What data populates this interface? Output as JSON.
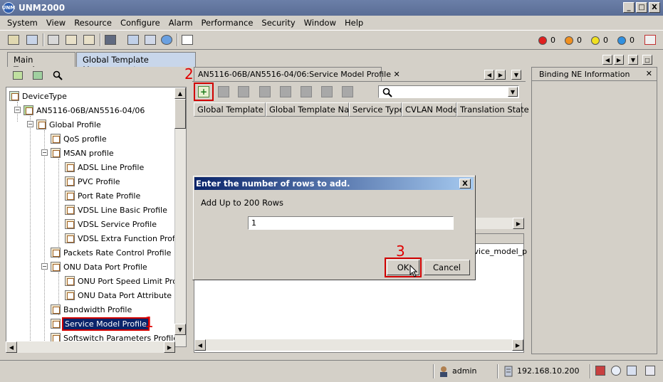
{
  "window": {
    "title": "UNM2000",
    "icon_text": "UNM",
    "minimize": "_",
    "restore": "□",
    "close": "X"
  },
  "menu": [
    "System",
    "View",
    "Resource",
    "Configure",
    "Alarm",
    "Performance",
    "Security",
    "Window",
    "Help"
  ],
  "alarm_counts": [
    {
      "color": "#e02020",
      "count": "0"
    },
    {
      "color": "#f09020",
      "count": "0"
    },
    {
      "color": "#f0e020",
      "count": "0"
    },
    {
      "color": "#3090e0",
      "count": "0"
    }
  ],
  "tabs": [
    {
      "label": "Main Topology"
    },
    {
      "label": "Global Template Management",
      "close": "✕"
    }
  ],
  "tree": {
    "items": [
      {
        "label": "DeviceType"
      },
      {
        "label": "AN5116-06B/AN5516-04/06"
      },
      {
        "label": "Global Profile"
      },
      {
        "label": "QoS profile"
      },
      {
        "label": "MSAN profile"
      },
      {
        "label": "ADSL Line Profile"
      },
      {
        "label": "PVC Profile"
      },
      {
        "label": "Port Rate Profile"
      },
      {
        "label": "VDSL Line Basic Profile"
      },
      {
        "label": "VDSL Service Profile"
      },
      {
        "label": "VDSL Extra Function Profile"
      },
      {
        "label": "Packets Rate Control Profile"
      },
      {
        "label": "ONU Data Port Profile"
      },
      {
        "label": "ONU Port Speed Limit Profile"
      },
      {
        "label": "ONU Data Port Attribute Pro"
      },
      {
        "label": "Bandwidth Profile"
      },
      {
        "label": "Service Model Profile",
        "selected": true
      },
      {
        "label": "Softswitch Parameters Profile"
      }
    ]
  },
  "annotations": {
    "step1": "1",
    "step2": "2",
    "step3": "3"
  },
  "middle": {
    "tab_label": "AN5116-06B/AN5516-04/06:Service Model Profile",
    "tab_close": "✕",
    "columns": [
      "Global Template ID",
      "Global Template Name",
      "Service Type",
      "CVLAN Mode",
      "Translation State"
    ],
    "lower_fragment": "rvice_model_p"
  },
  "right": {
    "title": "Binding NE Information",
    "close": "✕"
  },
  "dialog": {
    "title": "Enter the number of rows to add.",
    "close": "X",
    "message": "Add Up to 200 Rows",
    "value": "1",
    "ok": "OK",
    "cancel": "Cancel"
  },
  "status": {
    "user": "admin",
    "ip": "192.168.10.200"
  }
}
